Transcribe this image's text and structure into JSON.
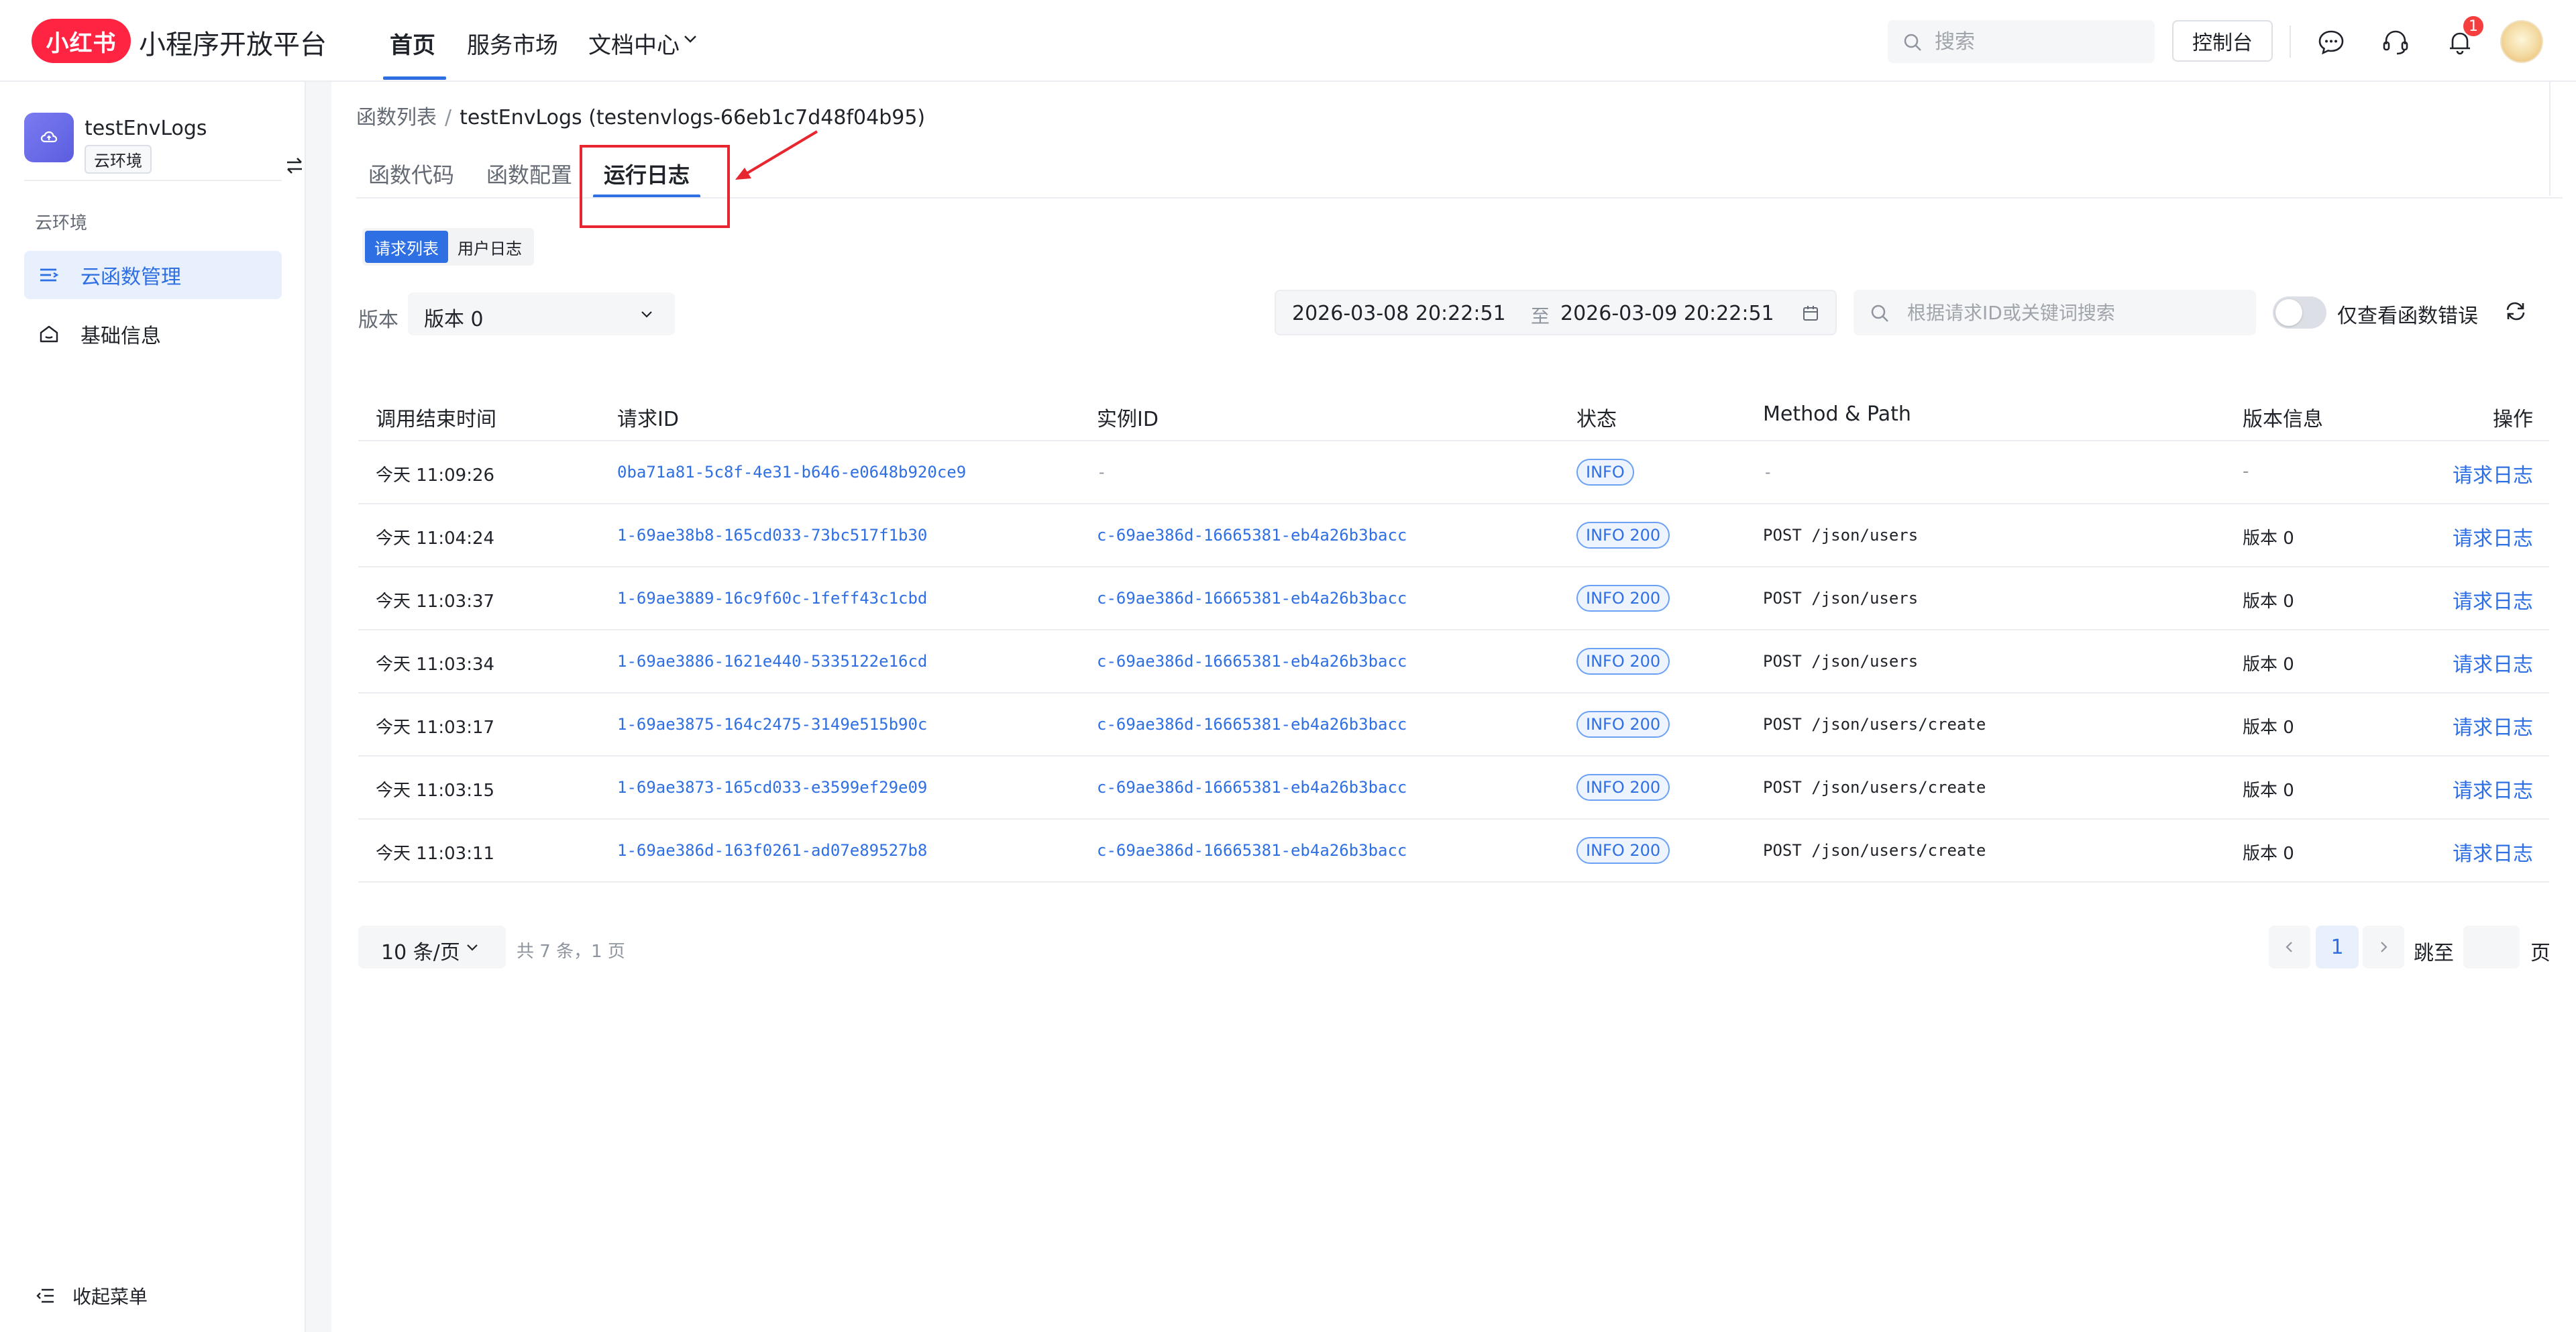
{
  "header": {
    "logo_text": "小红书",
    "brand": "小程序开放平台",
    "nav": [
      {
        "label": "首页",
        "active": true
      },
      {
        "label": "服务市场",
        "active": false
      },
      {
        "label": "文档中心",
        "active": false
      }
    ],
    "search_placeholder": "搜索",
    "console_label": "控制台",
    "notification_count": "1"
  },
  "sidebar": {
    "env_name": "testEnvLogs",
    "env_tag": "云环境",
    "section_label": "云环境",
    "items": [
      {
        "label": "云函数管理",
        "icon": "list-icon",
        "active": true
      },
      {
        "label": "基础信息",
        "icon": "home-icon",
        "active": false
      }
    ],
    "collapse_label": "收起菜单"
  },
  "breadcrumb": {
    "parent": "函数列表",
    "separator": "/",
    "current": "testEnvLogs (testenvlogs-66eb1c7d48f04b95)"
  },
  "tabs": [
    {
      "label": "函数代码",
      "active": false
    },
    {
      "label": "函数配置",
      "active": false
    },
    {
      "label": "运行日志",
      "active": true
    }
  ],
  "subtabs": [
    {
      "label": "请求列表",
      "active": true
    },
    {
      "label": "用户日志",
      "active": false
    }
  ],
  "filters": {
    "version_label": "版本",
    "version_value": "版本 0",
    "date_start": "2026-03-08 20:22:51",
    "date_to": "至",
    "date_end": "2026-03-09 20:22:51",
    "search_placeholder": "根据请求ID或关键词搜索",
    "error_toggle_label": "仅查看函数错误",
    "error_toggle_on": false
  },
  "table": {
    "columns": [
      "调用结束时间",
      "请求ID",
      "实例ID",
      "状态",
      "Method & Path",
      "版本信息",
      "操作"
    ],
    "rows": [
      {
        "time": "今天 11:09:26",
        "request_id": "0ba71a81-5c8f-4e31-b646-e0648b920ce9",
        "instance_id": "-",
        "status": "INFO",
        "method_path": "-",
        "version": "-",
        "action": "请求日志"
      },
      {
        "time": "今天 11:04:24",
        "request_id": "1-69ae38b8-165cd033-73bc517f1b30",
        "instance_id": "c-69ae386d-16665381-eb4a26b3bacc",
        "status": "INFO 200",
        "method_path": "POST /json/users",
        "version": "版本 0",
        "action": "请求日志"
      },
      {
        "time": "今天 11:03:37",
        "request_id": "1-69ae3889-16c9f60c-1feff43c1cbd",
        "instance_id": "c-69ae386d-16665381-eb4a26b3bacc",
        "status": "INFO 200",
        "method_path": "POST /json/users",
        "version": "版本 0",
        "action": "请求日志"
      },
      {
        "time": "今天 11:03:34",
        "request_id": "1-69ae3886-1621e440-5335122e16cd",
        "instance_id": "c-69ae386d-16665381-eb4a26b3bacc",
        "status": "INFO 200",
        "method_path": "POST /json/users",
        "version": "版本 0",
        "action": "请求日志"
      },
      {
        "time": "今天 11:03:17",
        "request_id": "1-69ae3875-164c2475-3149e515b90c",
        "instance_id": "c-69ae386d-16665381-eb4a26b3bacc",
        "status": "INFO 200",
        "method_path": "POST /json/users/create",
        "version": "版本 0",
        "action": "请求日志"
      },
      {
        "time": "今天 11:03:15",
        "request_id": "1-69ae3873-165cd033-e3599ef29e09",
        "instance_id": "c-69ae386d-16665381-eb4a26b3bacc",
        "status": "INFO 200",
        "method_path": "POST /json/users/create",
        "version": "版本 0",
        "action": "请求日志"
      },
      {
        "time": "今天 11:03:11",
        "request_id": "1-69ae386d-163f0261-ad07e89527b8",
        "instance_id": "c-69ae386d-16665381-eb4a26b3bacc",
        "status": "INFO 200",
        "method_path": "POST /json/users/create",
        "version": "版本 0",
        "action": "请求日志"
      }
    ]
  },
  "pagination": {
    "page_size": "10 条/页",
    "total": "共 7 条，1 页",
    "current_page": "1",
    "jump_label": "跳至",
    "page_suffix": "页"
  },
  "colors": {
    "accent": "#2f6fe4",
    "brand_red": "#ff2442",
    "annotation_red": "#e8262f"
  }
}
